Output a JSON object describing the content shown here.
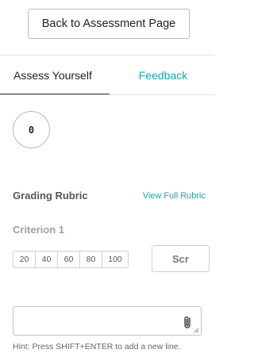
{
  "header": {
    "back_label": "Back to Assessment Page"
  },
  "tabs": [
    {
      "label": "Assess Yourself",
      "active": true
    },
    {
      "label": "Feedback",
      "active": false
    }
  ],
  "score_display": "0",
  "rubric": {
    "title": "Grading Rubric",
    "link_label": "View Full Rubric",
    "criterion_label": "Criterion 1",
    "scale": [
      "20",
      "40",
      "60",
      "80",
      "100"
    ],
    "score_placeholder": "Scr"
  },
  "comment": {
    "value": "",
    "attach_icon": "paperclip-icon",
    "hint": "Hint: Press SHIFT+ENTER to add a new line."
  },
  "colors": {
    "accent": "#1aa6b3",
    "text": "#333333",
    "muted": "#a0a0a0",
    "border": "#cfcfcf"
  }
}
